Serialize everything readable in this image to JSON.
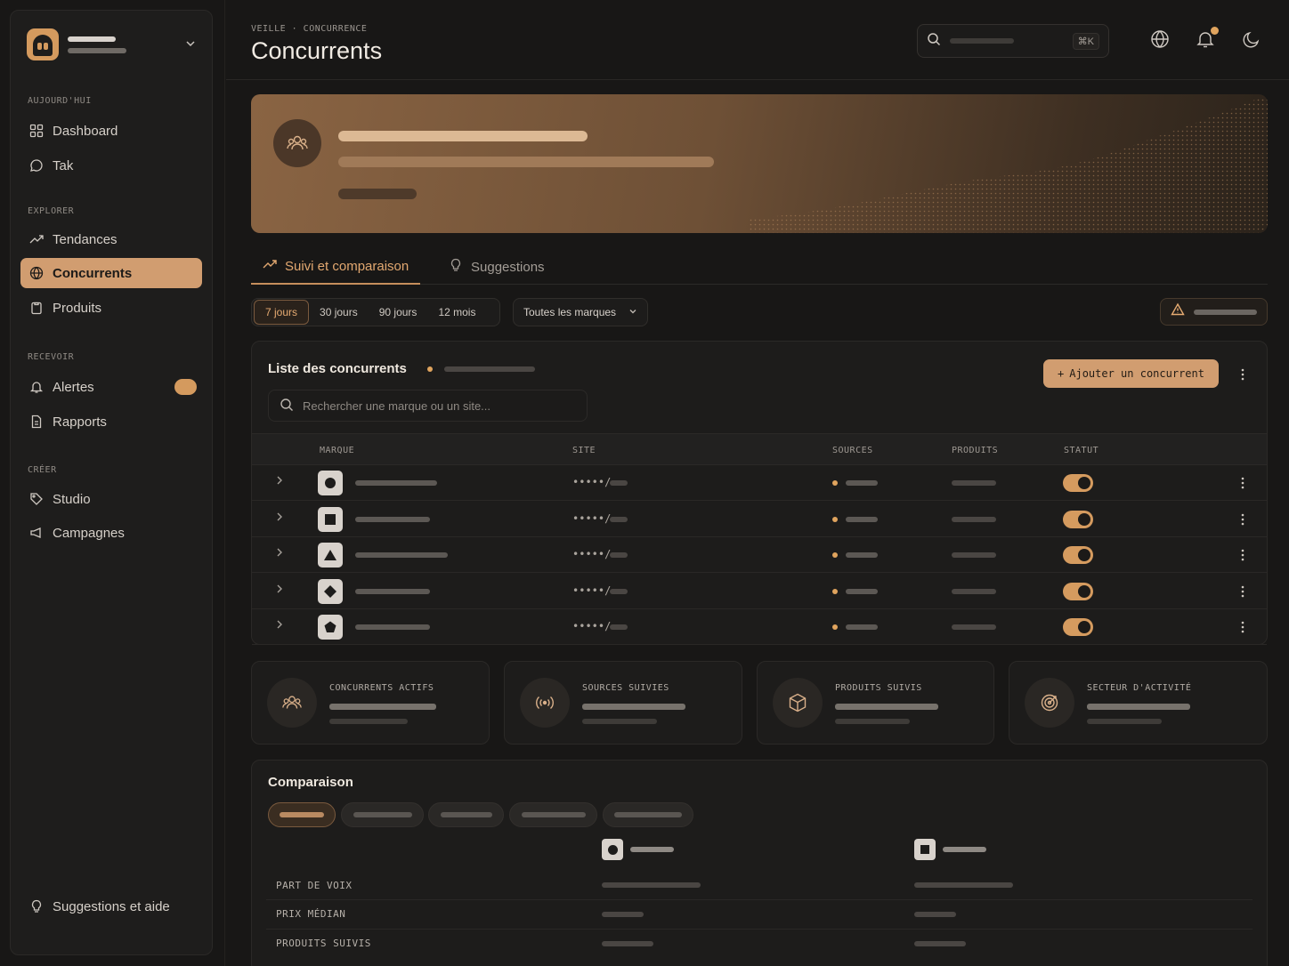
{
  "sidebar": {
    "sections": [
      {
        "title": "AUJOURD'HUI",
        "items": [
          {
            "label": "Dashboard",
            "icon": "grid-icon"
          },
          {
            "label": "Tak",
            "icon": "chat-icon"
          }
        ]
      },
      {
        "title": "EXPLORER",
        "items": [
          {
            "label": "Tendances",
            "icon": "trend-icon"
          },
          {
            "label": "Concurrents",
            "icon": "globe-icon",
            "active": true
          },
          {
            "label": "Produits",
            "icon": "clipboard-icon"
          }
        ]
      },
      {
        "title": "RECEVOIR",
        "items": [
          {
            "label": "Alertes",
            "icon": "bell-icon"
          },
          {
            "label": "Rapports",
            "icon": "document-icon"
          }
        ]
      },
      {
        "title": "CRÉER",
        "items": [
          {
            "label": "Studio",
            "icon": "brush-icon"
          },
          {
            "label": "Campagnes",
            "icon": "megaphone-icon"
          }
        ]
      }
    ],
    "footer": "Suggestions et aide"
  },
  "header": {
    "breadcrumb": "VEILLE · CONCURRENCE",
    "title": "Concurrents",
    "search_shortcut": "⌘K"
  },
  "tabs": [
    {
      "label": "Suivi et comparaison",
      "active": true
    },
    {
      "label": "Suggestions",
      "active": false
    }
  ],
  "filters": {
    "periods": [
      "7 jours",
      "30 jours",
      "90 jours",
      "12 mois"
    ],
    "active_period": "7 jours",
    "brand_select": "Toutes les marques"
  },
  "list": {
    "title": "Liste des concurrents",
    "add_button": "Ajouter un concurrent",
    "search_placeholder": "Rechercher une marque ou un site...",
    "columns": [
      "MARQUE",
      "SITE",
      "SOURCES",
      "PRODUITS",
      "STATUT"
    ],
    "rows": [
      {
        "shape": "circle",
        "site": "•••••/",
        "status_on": true
      },
      {
        "shape": "square",
        "site": "•••••/",
        "status_on": true
      },
      {
        "shape": "triangle",
        "site": "•••••/",
        "status_on": true
      },
      {
        "shape": "diamond",
        "site": "•••••/",
        "status_on": true
      },
      {
        "shape": "pentagon",
        "site": "•••••/",
        "status_on": true
      }
    ]
  },
  "stats": [
    {
      "label": "CONCURRENTS ACTIFS",
      "icon": "people-icon"
    },
    {
      "label": "SOURCES SUIVIES",
      "icon": "broadcast-icon"
    },
    {
      "label": "PRODUITS SUIVIS",
      "icon": "box-icon"
    },
    {
      "label": "SECTEUR D'ACTIVITÉ",
      "icon": "target-icon"
    }
  ],
  "comparison": {
    "title": "Comparaison",
    "rows": [
      "PART DE VOIX",
      "PRIX MÉDIAN",
      "PRODUITS SUIVIS"
    ]
  },
  "colors": {
    "accent": "#d19d70",
    "background": "#181716",
    "panel": "#1d1c1b"
  }
}
